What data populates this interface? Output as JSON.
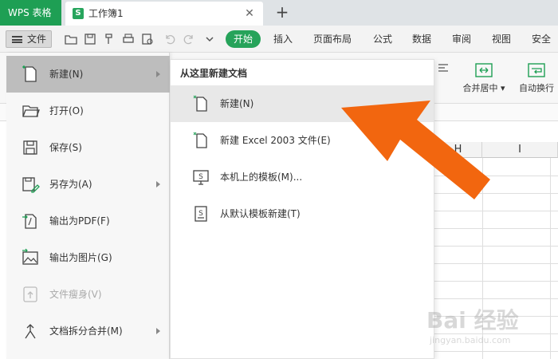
{
  "titlebar": {
    "app_name": "WPS 表格",
    "doc_badge": "S",
    "doc_name": "工作簿1",
    "close_glyph": "✕",
    "new_tab_glyph": "+"
  },
  "toolbar": {
    "file_label": "文件",
    "tabs": [
      "开始",
      "插入",
      "页面布局",
      "公式",
      "数据",
      "审阅",
      "视图",
      "安全"
    ]
  },
  "ribbon": {
    "merge_label": "合并居中",
    "wrap_label": "自动换行"
  },
  "sheet": {
    "columns": [
      "H",
      "I"
    ]
  },
  "file_menu": {
    "items": [
      {
        "label": "新建(N)",
        "icon": "new-doc-icon",
        "has_submenu": true,
        "active": true
      },
      {
        "label": "打开(O)",
        "icon": "folder-open-icon",
        "has_submenu": false
      },
      {
        "label": "保存(S)",
        "icon": "save-icon",
        "has_submenu": false
      },
      {
        "label": "另存为(A)",
        "icon": "save-as-icon",
        "has_submenu": true
      },
      {
        "label": "输出为PDF(F)",
        "icon": "export-pdf-icon",
        "has_submenu": false
      },
      {
        "label": "输出为图片(G)",
        "icon": "export-image-icon",
        "has_submenu": false
      },
      {
        "label": "文件瘦身(V)",
        "icon": "slim-file-icon",
        "has_submenu": false,
        "disabled": true
      },
      {
        "label": "文档拆分合并(M)",
        "icon": "split-merge-icon",
        "has_submenu": true
      }
    ]
  },
  "sub_menu": {
    "title": "从这里新建文档",
    "items": [
      {
        "label": "新建(N)",
        "icon": "new-doc-icon",
        "active": true
      },
      {
        "label": "新建 Excel 2003 文件(E)",
        "icon": "new-excel-icon"
      },
      {
        "label": "本机上的模板(M)...",
        "icon": "local-template-icon"
      },
      {
        "label": "从默认模板新建(T)",
        "icon": "default-template-icon"
      }
    ]
  },
  "watermark": {
    "text": "Bai 经验",
    "url": "jingyan.baidu.com"
  },
  "colors": {
    "brand_green": "#1e9f54",
    "arrow_orange": "#f2660f"
  }
}
